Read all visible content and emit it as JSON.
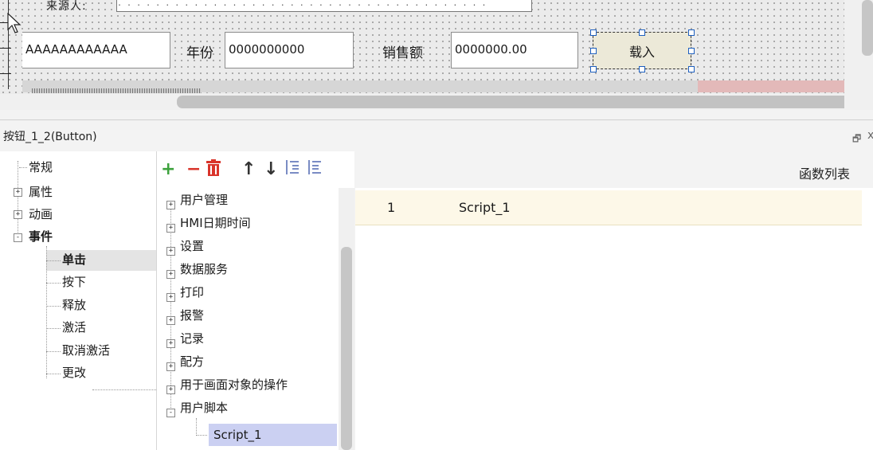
{
  "canvas": {
    "cutoff_label": "来源人:",
    "cutoff_input": ". . . . . . . . . . . . . . . . . . . . . . . . . . . . . . . . . . . . . . .",
    "name_field_value": "AAAAAAAAAAAA",
    "year_label": "年份",
    "year_value": "0000000000",
    "sales_label": "销售额",
    "sales_value": "0000000.00",
    "load_button_label": "载入"
  },
  "panel": {
    "title": "按钮_1_2(Button)",
    "restore_glyph": "🗗",
    "close_glyph": "x"
  },
  "left_tree": {
    "items": [
      {
        "label": "常规",
        "expander": "",
        "bold": false
      },
      {
        "label": "属性",
        "expander": "+",
        "bold": false
      },
      {
        "label": "动画",
        "expander": "+",
        "bold": false
      },
      {
        "label": "事件",
        "expander": "-",
        "bold": true
      }
    ],
    "event_children": [
      "单击",
      "按下",
      "释放",
      "激活",
      "取消激活",
      "更改"
    ],
    "selected": "单击"
  },
  "toolbar": {
    "icons": [
      {
        "name": "add-icon",
        "glyph": "+",
        "color": "#3da23d"
      },
      {
        "name": "remove-icon",
        "glyph": "−",
        "color": "#d9342b"
      },
      {
        "name": "delete-icon",
        "glyph": "🗑",
        "color": "#d9342b"
      },
      {
        "name": "move-up-icon",
        "glyph": "↑",
        "color": "#333333"
      },
      {
        "name": "move-down-icon",
        "glyph": "↓",
        "color": "#333333"
      },
      {
        "name": "indent-icon",
        "glyph": "⇤",
        "color": "#7a8cc4"
      },
      {
        "name": "outdent-icon",
        "glyph": "⇥",
        "color": "#7a8cc4"
      }
    ]
  },
  "function_tree": {
    "items": [
      {
        "label": "用户管理",
        "expander": "+"
      },
      {
        "label": "HMI日期时间",
        "expander": "+"
      },
      {
        "label": "设置",
        "expander": "+"
      },
      {
        "label": "数据服务",
        "expander": "+"
      },
      {
        "label": "打印",
        "expander": "+"
      },
      {
        "label": "报警",
        "expander": "+"
      },
      {
        "label": "记录",
        "expander": "+"
      },
      {
        "label": "配方",
        "expander": "+"
      },
      {
        "label": "用于画面对象的操作",
        "expander": "+"
      },
      {
        "label": "用户脚本",
        "expander": "-"
      }
    ],
    "script_child": "Script_1"
  },
  "function_list": {
    "header": "函数列表",
    "rows": [
      {
        "index": "1",
        "name": "Script_1"
      }
    ]
  }
}
